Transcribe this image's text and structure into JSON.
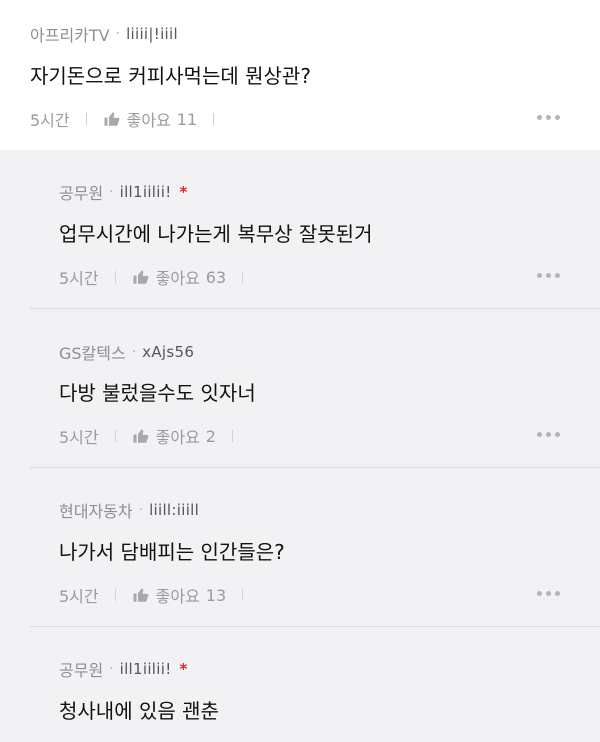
{
  "post": {
    "company": "아프리카TV",
    "nickname": "liiii|!iiil",
    "text": "자기돈으로 커피사먹는데 뭔상관?",
    "time": "5시간",
    "like_label": "좋아요",
    "likes": "11"
  },
  "replies": [
    {
      "company": "공무원",
      "nickname": "ill1iilii!",
      "verified": "*",
      "text": "업무시간에 나가는게 복무상 잘못된거",
      "time": "5시간",
      "like_label": "좋아요",
      "likes": "63"
    },
    {
      "company": "GS칼텍스",
      "nickname": "xAjs56",
      "verified": "",
      "text": "다방 불렀을수도 잇자너",
      "time": "5시간",
      "like_label": "좋아요",
      "likes": "2"
    },
    {
      "company": "현대자동차",
      "nickname": "liill:iiill",
      "verified": "",
      "text": "나가서 담배피는 인간들은?",
      "time": "5시간",
      "like_label": "좋아요",
      "likes": "13"
    },
    {
      "company": "공무원",
      "nickname": "ill1iilii!",
      "verified": "*",
      "text": "청사내에 있음 괜춘"
    }
  ],
  "icons": {
    "like": "thumbs-up-icon",
    "more": "more-dots-icon"
  },
  "colors": {
    "reply_background": "#f2f2f4",
    "verified_star": "#e0262f"
  }
}
